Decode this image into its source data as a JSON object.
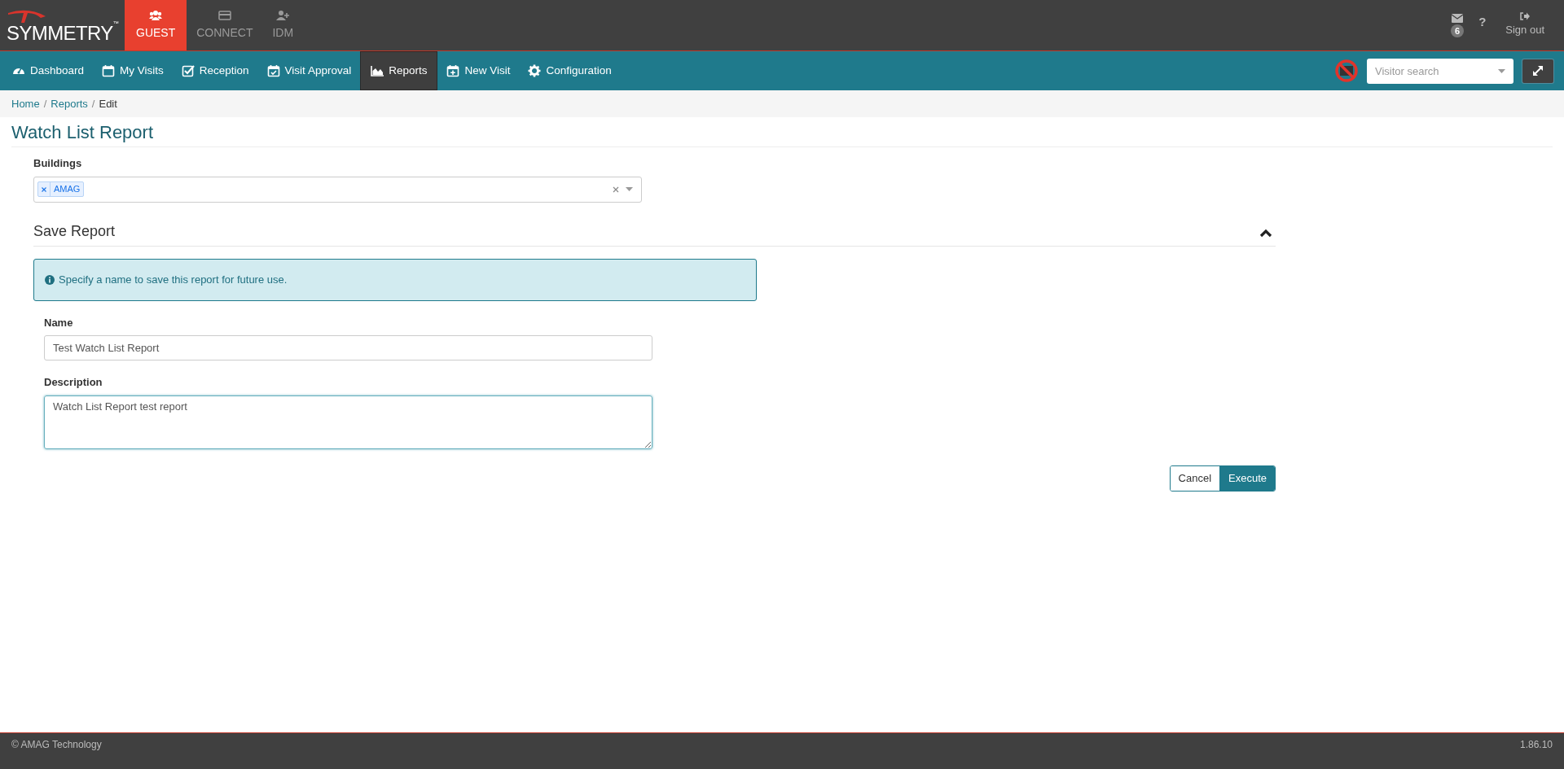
{
  "brand": {
    "name": "SYMMETRY",
    "trademark": "™"
  },
  "modules": [
    {
      "label": "GUEST",
      "selected": true
    },
    {
      "label": "CONNECT",
      "selected": false
    },
    {
      "label": "IDM",
      "selected": false
    }
  ],
  "header_actions": {
    "messages_badge": "6",
    "help": "?",
    "sign_out": "Sign out"
  },
  "nav": [
    {
      "label": "Dashboard",
      "selected": false
    },
    {
      "label": "My Visits",
      "selected": false
    },
    {
      "label": "Reception",
      "selected": false
    },
    {
      "label": "Visit Approval",
      "selected": false
    },
    {
      "label": "Reports",
      "selected": true
    },
    {
      "label": "New Visit",
      "selected": false
    },
    {
      "label": "Configuration",
      "selected": false
    }
  ],
  "visitor_search": {
    "placeholder": "Visitor search"
  },
  "breadcrumb": [
    {
      "label": "Home",
      "current": false,
      "separator": "/"
    },
    {
      "label": "Reports",
      "current": false,
      "separator": "/"
    },
    {
      "label": "Edit",
      "current": true
    }
  ],
  "page_title": "Watch List Report",
  "buildings": {
    "label": "Buildings",
    "tags": [
      "AMAG"
    ]
  },
  "save_report": {
    "title": "Save Report",
    "expanded": true,
    "info": "Specify a name to save this report for future use.",
    "fields": [
      {
        "label": "Name",
        "kind": "input",
        "value": "Test Watch List Report",
        "focused": false
      },
      {
        "label": "Description",
        "kind": "textarea",
        "value": "Watch List Report test report",
        "focused": true
      }
    ]
  },
  "buttons": [
    {
      "label": "Cancel",
      "kind": "default"
    },
    {
      "label": "Execute",
      "kind": "primary"
    }
  ],
  "footer": {
    "copyright": "© AMAG Technology",
    "version": "1.86.10"
  }
}
